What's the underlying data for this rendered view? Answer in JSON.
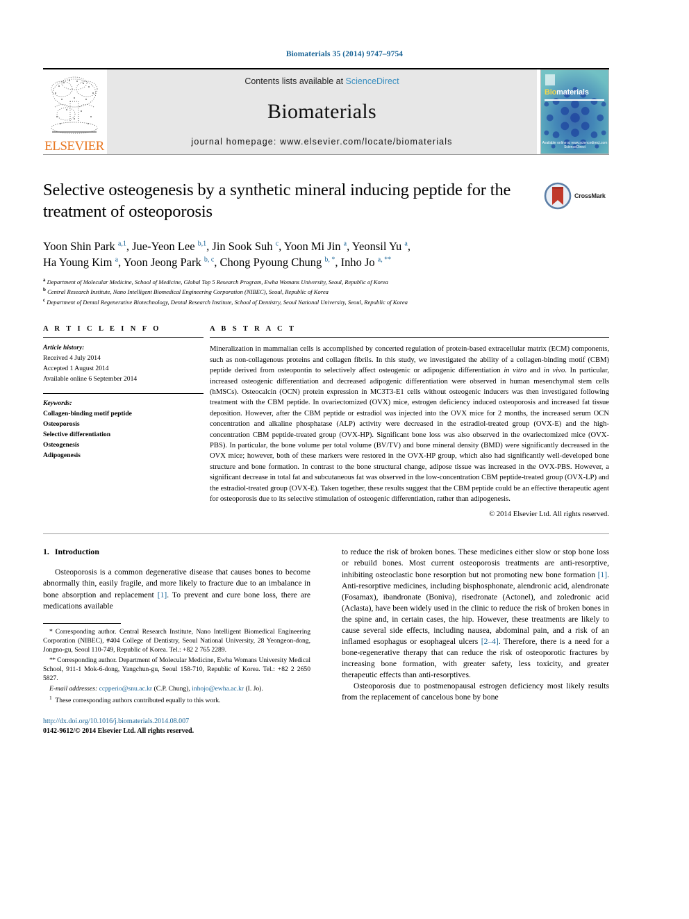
{
  "running_head": "Biomaterials 35 (2014) 9747–9754",
  "masthead": {
    "contents_prefix": "Contents lists available at ",
    "sciencedirect": "ScienceDirect",
    "journal_name": "Biomaterials",
    "homepage": "journal homepage: www.elsevier.com/locate/biomaterials",
    "publisher_logo_text": "ELSEVIER",
    "cover": {
      "title_part1": "Bio",
      "title_part2": "materials",
      "footer_line1": "Available online at www.sciencedirect.com",
      "footer_line2": "ScienceDirect"
    }
  },
  "article": {
    "title": "Selective osteogenesis by a synthetic mineral inducing peptide for the treatment of osteoporosis",
    "crossmark_label": "CrossMark",
    "authors_line1_html": "Yoon Shin Park <sup>a,1</sup>, Jue-Yeon Lee <sup>b,1</sup>, Jin Sook Suh <sup>c</sup>, Yoon Mi Jin <sup>a</sup>, Yeonsil Yu <sup>a</sup>,",
    "authors_line2_html": "Ha Young Kim <sup>a</sup>, Yoon Jeong Park <sup>b, c</sup>, Chong Pyoung Chung <sup>b, *</sup>, Inho Jo <sup>a, **</sup>",
    "affiliations": [
      {
        "mark": "a",
        "text": "Department of Molecular Medicine, School of Medicine, Global Top 5 Research Program, Ewha Womans University, Seoul, Republic of Korea"
      },
      {
        "mark": "b",
        "text": "Central Research Institute, Nano Intelligent Biomedical Engineering Corporation (NIBEC), Seoul, Republic of Korea"
      },
      {
        "mark": "c",
        "text": "Department of Dental Regenerative Biotechnology, Dental Research Institute, School of Dentistry, Seoul National University, Seoul, Republic of Korea"
      }
    ]
  },
  "article_info": {
    "heading": "A R T I C L E    I N F O",
    "history_title": "Article history:",
    "history": [
      "Received 4 July 2014",
      "Accepted 1 August 2014",
      "Available online 6 September 2014"
    ],
    "keywords_title": "Keywords:",
    "keywords": [
      "Collagen-binding motif peptide",
      "Osteoporosis",
      "Selective differentiation",
      "Osteogenesis",
      "Adipogenesis"
    ]
  },
  "abstract": {
    "heading": "A B S T R A C T",
    "text_html": "Mineralization in mammalian cells is accomplished by concerted regulation of protein-based extracellular matrix (ECM) components, such as non-collagenous proteins and collagen fibrils. In this study, we investigated the ability of a collagen-binding motif (CBM) peptide derived from osteopontin to selectively affect osteogenic or adipogenic differentiation <i>in vitro</i> and <i>in vivo</i>. In particular, increased osteogenic differentiation and decreased adipogenic differentiation were observed in human mesenchymal stem cells (hMSCs). Osteocalcin (OCN) protein expression in MC3T3-E1 cells without osteogenic inducers was then investigated following treatment with the CBM peptide. In ovariectomized (OVX) mice, estrogen deficiency induced osteoporosis and increased fat tissue deposition. However, after the CBM peptide or estradiol was injected into the OVX mice for 2 months, the increased serum OCN concentration and alkaline phosphatase (ALP) activity were decreased in the estradiol-treated group (OVX-E) and the high-concentration CBM peptide-treated group (OVX-HP). Significant bone loss was also observed in the ovariectomized mice (OVX-PBS). In particular, the bone volume per total volume (BV/TV) and bone mineral density (BMD) were significantly decreased in the OVX mice; however, both of these markers were restored in the OVX-HP group, which also had significantly well-developed bone structure and bone formation. In contrast to the bone structural change, adipose tissue was increased in the OVX-PBS. However, a significant decrease in total fat and subcutaneous fat was observed in the low-concentration CBM peptide-treated group (OVX-LP) and the estradiol-treated group (OVX-E). Taken together, these results suggest that the CBM peptide could be an effective therapeutic agent for osteoporosis due to its selective stimulation of osteogenic differentiation, rather than adipogenesis.",
    "copyright": "© 2014 Elsevier Ltd. All rights reserved."
  },
  "introduction": {
    "number": "1.",
    "heading": "Introduction",
    "para1_html": "Osteoporosis is a common degenerative disease that causes bones to become abnormally thin, easily fragile, and more likely to fracture due to an imbalance in bone absorption and replacement <span class=\"ref\">[1]</span>. To prevent and cure bone loss, there are medications available",
    "para1_cont_html": "to reduce the risk of broken bones. These medicines either slow or stop bone loss or rebuild bones. Most current osteoporosis treatments are anti-resorptive, inhibiting osteoclastic bone resorption but not promoting new bone formation <span class=\"ref\">[1]</span>. Anti-resorptive medicines, including bisphosphonate, alendronic acid, alendronate (Fosamax), ibandronate (Boniva), risedronate (Actonel), and zoledronic acid (Aclasta), have been widely used in the clinic to reduce the risk of broken bones in the spine and, in certain cases, the hip. However, these treatments are likely to cause several side effects, including nausea, abdominal pain, and a risk of an inflamed esophagus or esophageal ulcers <span class=\"ref\">[2–4]</span>. Therefore, there is a need for a bone-regenerative therapy that can reduce the risk of osteoporotic fractures by increasing bone formation, with greater safety, less toxicity, and greater therapeutic effects than anti-resorptives.",
    "para2_html": "Osteoporosis due to postmenopausal estrogen deficiency most likely results from the replacement of cancelous bone by bone"
  },
  "footnotes": {
    "corr1_html": "<span class=\"star\">*</span> Corresponding author. Central Research Institute, Nano Intelligent Biomedical Engineering Corporation (NIBEC), #404 College of Dentistry, Seoul National University, 28 Yeongeon-dong, Jongno-gu, Seoul 110-749, Republic of Korea. Tel.: +82 2 765 2289.",
    "corr2_html": "<span class=\"star\">**</span> Corresponding author. Department of Molecular Medicine, Ewha Womans University Medical School, 911-1 Mok-6-dong, Yangchun-gu, Seoul 158-710, Republic of Korea. Tel.: +82 2 2650 5827.",
    "email_label": "E-mail addresses:",
    "email1": "ccpperio@snu.ac.kr",
    "email1_owner": "(C.P. Chung)",
    "email2": "inhojo@ewha.ac.kr",
    "email2_owner": "(I. Jo).",
    "equal_contrib_html": "<sup>1</sup>&nbsp; These corresponding authors contributed equally to this work."
  },
  "footer": {
    "doi": "http://dx.doi.org/10.1016/j.biomaterials.2014.08.007",
    "issn_line": "0142-9612/© 2014 Elsevier Ltd. All rights reserved."
  },
  "colors": {
    "link_blue": "#1a6496",
    "elsevier_orange": "#E87722",
    "sciencedirect_blue": "#3a8fc0"
  }
}
